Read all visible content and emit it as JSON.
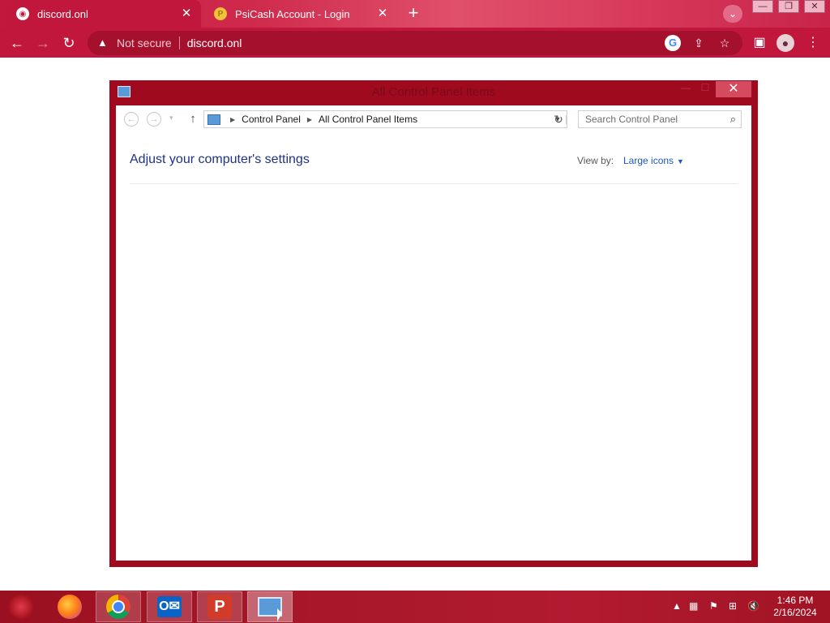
{
  "browser": {
    "tabs": [
      {
        "title": "discord.onl",
        "active": true
      },
      {
        "title": "PsiCash Account - Login",
        "active": false
      }
    ],
    "address": {
      "security_label": "Not secure",
      "url": "discord.onl"
    }
  },
  "window": {
    "title": "All Control Panel Items",
    "breadcrumb": [
      "Control Panel",
      "All Control Panel Items"
    ],
    "search_placeholder": "Search Control Panel",
    "heading": "Adjust your computer's settings",
    "view_by_label": "View by:",
    "view_by_value": "Large icons"
  },
  "taskbar": {
    "apps": [
      "start-orb",
      "firefox",
      "chrome",
      "outlook",
      "psiphon",
      "control-panel"
    ],
    "clock": {
      "time": "1:46 PM",
      "date": "2/16/2024"
    }
  },
  "colors": {
    "browser_accent": "#c2173c",
    "window_frame": "#9f0a1f",
    "heading": "#1e3287",
    "link": "#1e58b8"
  }
}
